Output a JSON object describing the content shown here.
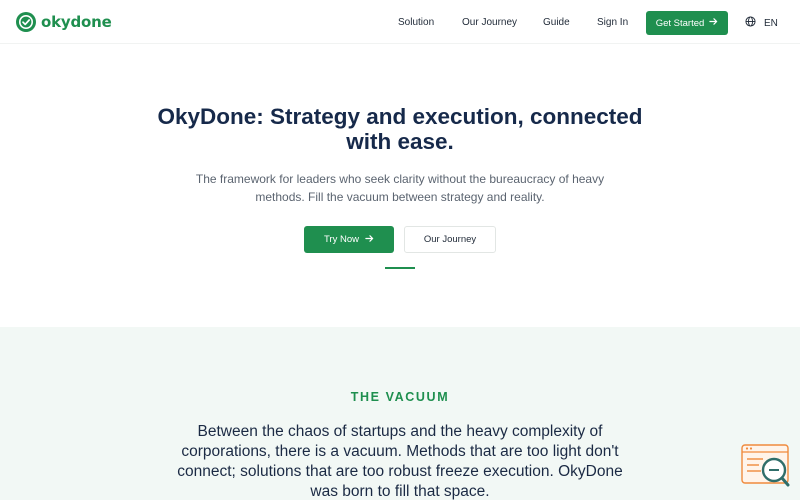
{
  "brand": {
    "name": "okydone",
    "color": "#1f8f4f"
  },
  "nav": {
    "items": [
      "Solution",
      "Our Journey",
      "Guide",
      "Sign In"
    ],
    "cta_label": "Get Started",
    "language": "EN"
  },
  "hero": {
    "title_line1": "OkyDone: Strategy and execution, connected",
    "title_line2": "with ease.",
    "subtitle_line1": "The framework for leaders who seek clarity without the bureaucracy of heavy",
    "subtitle_line2": "methods. Fill the vacuum between strategy and reality.",
    "primary_label": "Try Now",
    "secondary_label": "Our Journey"
  },
  "vacuum": {
    "heading": "THE VACUUM",
    "body_lines": [
      "Between the chaos of startups and the heavy complexity of",
      "corporations, there is a vacuum. Methods that are too light don't",
      "connect; solutions that are too robust freeze execution. OkyDone",
      "was born to fill that space."
    ]
  },
  "icons": {
    "logo": "okydone-logo-icon",
    "arrow": "arrow-right-icon",
    "globe": "globe-icon",
    "widget": "search-chat-widget-icon"
  },
  "colors": {
    "accent": "#1f8f4f",
    "heading": "#16294a",
    "section_bg": "#f2f8f5",
    "widget_orange": "#f08a3c",
    "widget_teal": "#2f6e6a"
  }
}
